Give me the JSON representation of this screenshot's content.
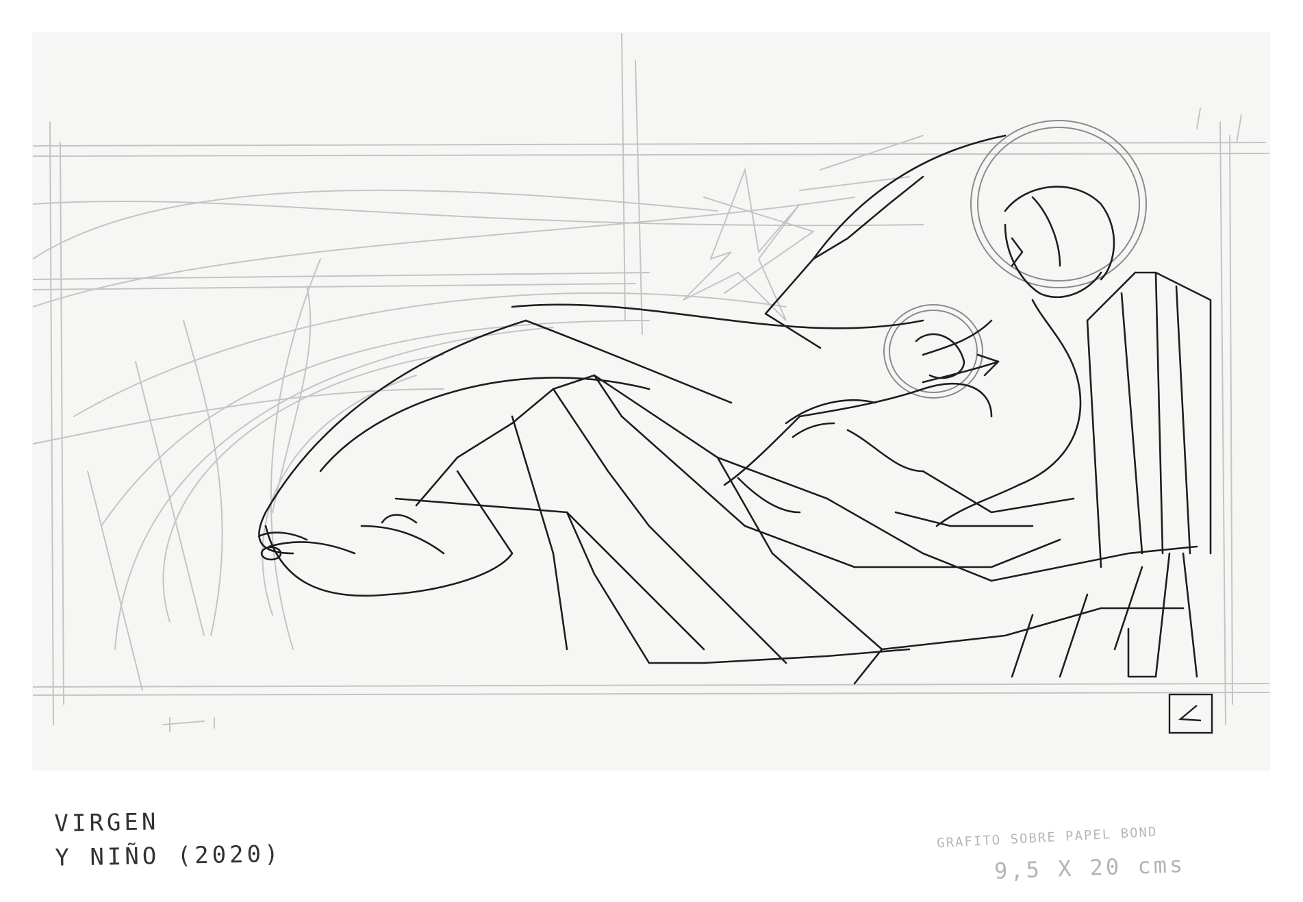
{
  "artwork": {
    "title_line1": "VIRGEN",
    "title_line2": "Y NIÑO (2020)",
    "medium": "GRAFITO SOBRE PAPEL BOND",
    "dimensions": "9,5 X 20 cms",
    "signature": "L"
  },
  "colors": {
    "paper": "#f6f6f4",
    "light_graphite": "#bdbdbd",
    "dark_graphite": "#1e1e1e"
  }
}
